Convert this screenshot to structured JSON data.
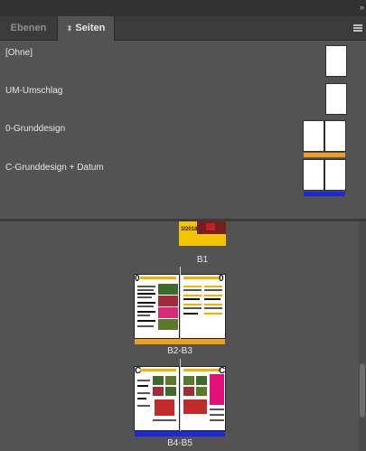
{
  "panel": {
    "collapse_glyph": "»",
    "tabs": [
      {
        "label": "Ebenen",
        "active": false
      },
      {
        "label": "Seiten",
        "active": true,
        "icon": "sort-arrows-icon"
      }
    ],
    "menu_icon": "panel-menu-icon"
  },
  "masters": [
    {
      "label": "[Ohne]",
      "pages": 1,
      "color": null
    },
    {
      "label": "UM-Umschlag",
      "pages": 1,
      "color": null
    },
    {
      "label": "0-Grunddesign",
      "pages": 2,
      "color": "#f0a020"
    },
    {
      "label": "C-Grunddesign + Datum",
      "pages": 2,
      "color": "#1a2ad8"
    }
  ],
  "spreads": [
    {
      "label": "B1",
      "thumb_text": "3/2018",
      "color": null
    },
    {
      "label": "B2-B3",
      "prefix_left": "0",
      "prefix_right": "0",
      "color": "#f0a020"
    },
    {
      "label": "B4-B5",
      "prefix_left": "C",
      "prefix_right": "C",
      "color": "#1a2ad8"
    }
  ],
  "colors": {
    "panel_bg": "#535353",
    "tab_bar": "#3b3b3b",
    "accent_orange": "#f0a020",
    "accent_blue": "#1a2ad8",
    "cover_yellow": "#f5c400"
  }
}
